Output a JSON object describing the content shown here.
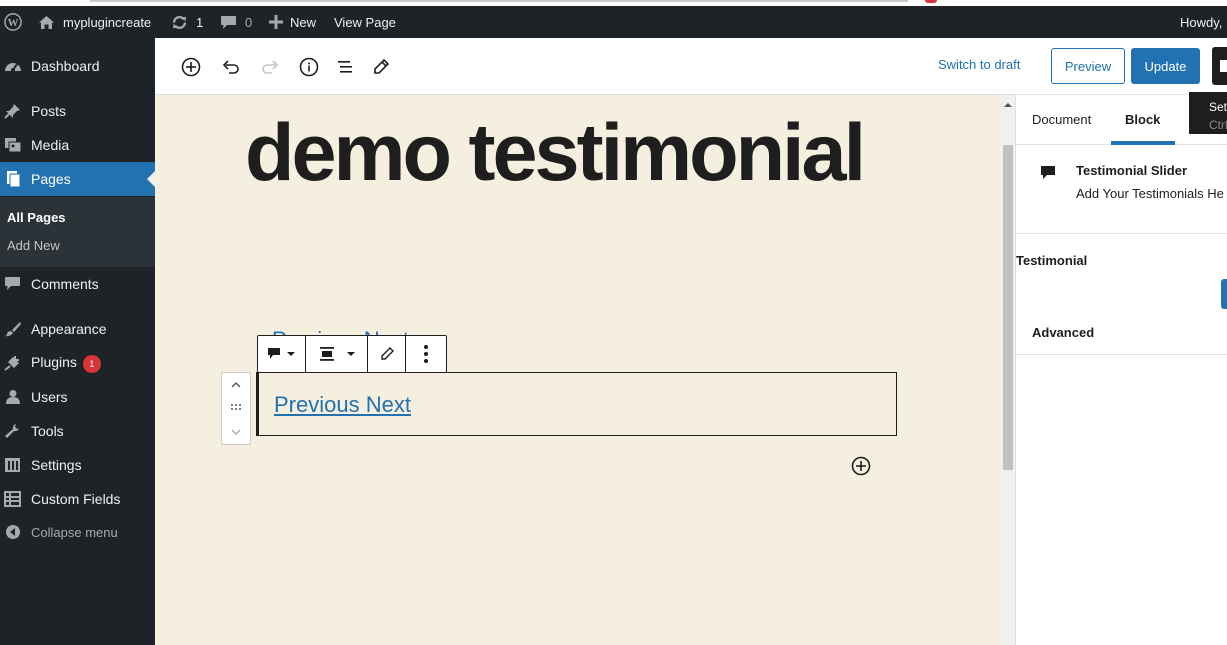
{
  "adminbar": {
    "site_name": "myplugincreate",
    "updates_count": "1",
    "comments_count": "0",
    "new_label": "New",
    "view_page_label": "View Page",
    "howdy": "Howdy,"
  },
  "menu": {
    "dashboard": "Dashboard",
    "posts": "Posts",
    "media": "Media",
    "pages": "Pages",
    "all_pages": "All Pages",
    "add_new": "Add New",
    "comments": "Comments",
    "appearance": "Appearance",
    "plugins": "Plugins",
    "plugins_badge": "1",
    "users": "Users",
    "tools": "Tools",
    "settings": "Settings",
    "custom_fields": "Custom Fields",
    "collapse": "Collapse menu"
  },
  "header": {
    "switch_to_draft": "Switch to draft",
    "preview": "Preview",
    "update": "Update",
    "tooltip_title": "Set",
    "tooltip_shortcut": "Ctrl+"
  },
  "canvas": {
    "title": "demo testimonial",
    "ghost_link": "Previous Next",
    "block_link": "Previous Next"
  },
  "sidebar": {
    "tab_document": "Document",
    "tab_block": "Block",
    "block_name": "Testimonial Slider",
    "block_desc": "Add Your Testimonials He",
    "panel_testimonial": "Testimonial",
    "panel_advanced": "Advanced"
  },
  "colors": {
    "admin_dark": "#1d2327",
    "accent": "#2271b1",
    "canvas_bg": "#f5efe0",
    "badge": "#d63638"
  }
}
